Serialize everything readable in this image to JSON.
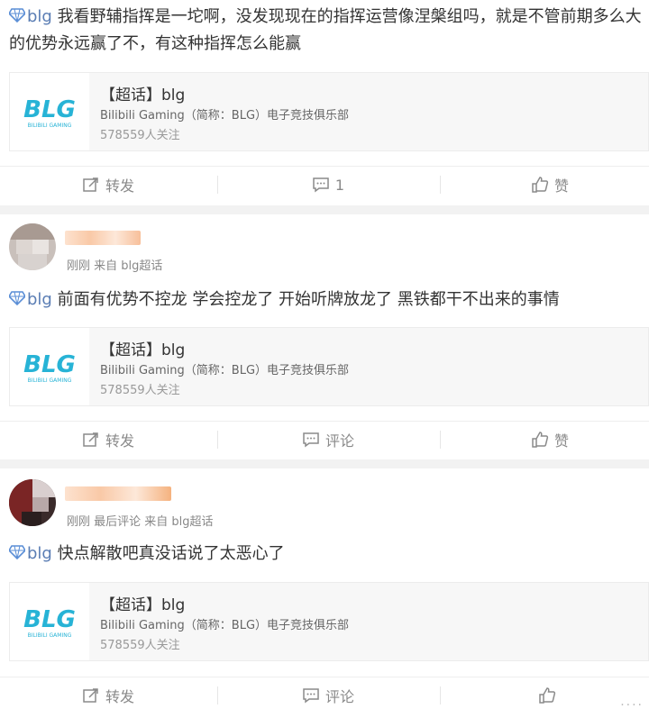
{
  "posts": [
    {
      "topic": "blg",
      "text": "我看野辅指挥是一坨啊，没发现现在的指挥运营像涅槃组吗，就是不管前期多么大的优势永远赢了不，有这种指挥怎么能赢",
      "card": {
        "title": "【超话】blg",
        "subtitle": "Bilibili Gaming（简称：BLG）电子竞技俱乐部",
        "followers": "578559人关注",
        "logo_text": "BLG",
        "logo_sub": "BILIBILI GAMING"
      },
      "actions": {
        "repost": "转发",
        "comment": "1",
        "like": "赞"
      }
    },
    {
      "meta": "刚刚 来自 blg超话",
      "topic": "blg",
      "text": "前面有优势不控龙 学会控龙了 开始听牌放龙了 黑铁都干不出来的事情",
      "card": {
        "title": "【超话】blg",
        "subtitle": "Bilibili Gaming（简称：BLG）电子竞技俱乐部",
        "followers": "578559人关注",
        "logo_text": "BLG",
        "logo_sub": "BILIBILI GAMING"
      },
      "actions": {
        "repost": "转发",
        "comment": "评论",
        "like": "赞"
      }
    },
    {
      "meta": "刚刚 最后评论 来自 blg超话",
      "topic": "blg",
      "text": "快点解散吧真没话说了太恶心了",
      "card": {
        "title": "【超话】blg",
        "subtitle": "Bilibili Gaming（简称：BLG）电子竞技俱乐部",
        "followers": "578559人关注",
        "logo_text": "BLG",
        "logo_sub": "BILIBILI GAMING"
      },
      "actions": {
        "repost": "转发",
        "comment": "评论",
        "like": ""
      }
    }
  ],
  "watermark": "····",
  "colors": {
    "topic": "#5a7db4",
    "logo": "#27b3d6",
    "diamond": "#5a8ed6",
    "blur_orange": "#f7b88a"
  }
}
